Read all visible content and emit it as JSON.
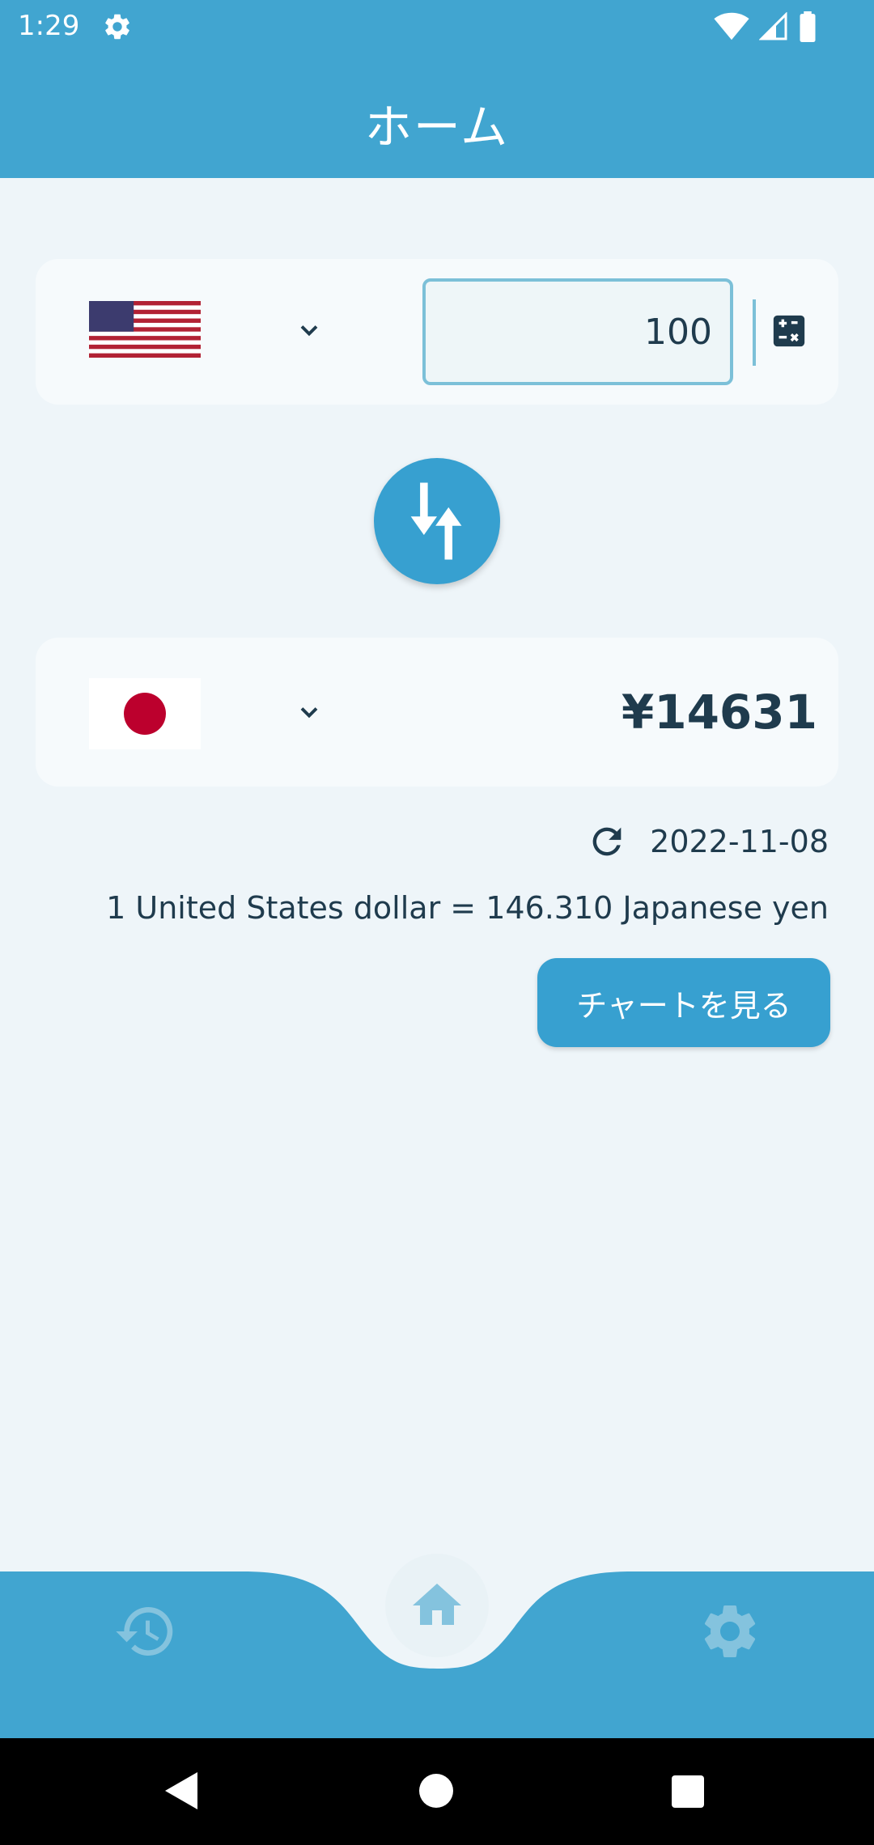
{
  "status_bar": {
    "time": "1:29"
  },
  "app_bar": {
    "title": "ホーム"
  },
  "from_currency": {
    "flag_icon": "us-flag-icon",
    "amount": "100",
    "amount_placeholder": ""
  },
  "to_currency": {
    "flag_icon": "jp-flag-icon",
    "result": "¥14631"
  },
  "rate_info": {
    "date": "2022-11-08",
    "rate_text": "1 United States dollar = 146.310 Japanese yen"
  },
  "chart_button": {
    "label": "チャートを見る"
  },
  "bottom_nav": {
    "items": [
      "history-icon",
      "home-icon",
      "settings-icon"
    ]
  },
  "colors": {
    "primary": "#41a5d0",
    "button": "#37a0d0",
    "background": "#eef5f9",
    "text": "#1f3b4d"
  }
}
